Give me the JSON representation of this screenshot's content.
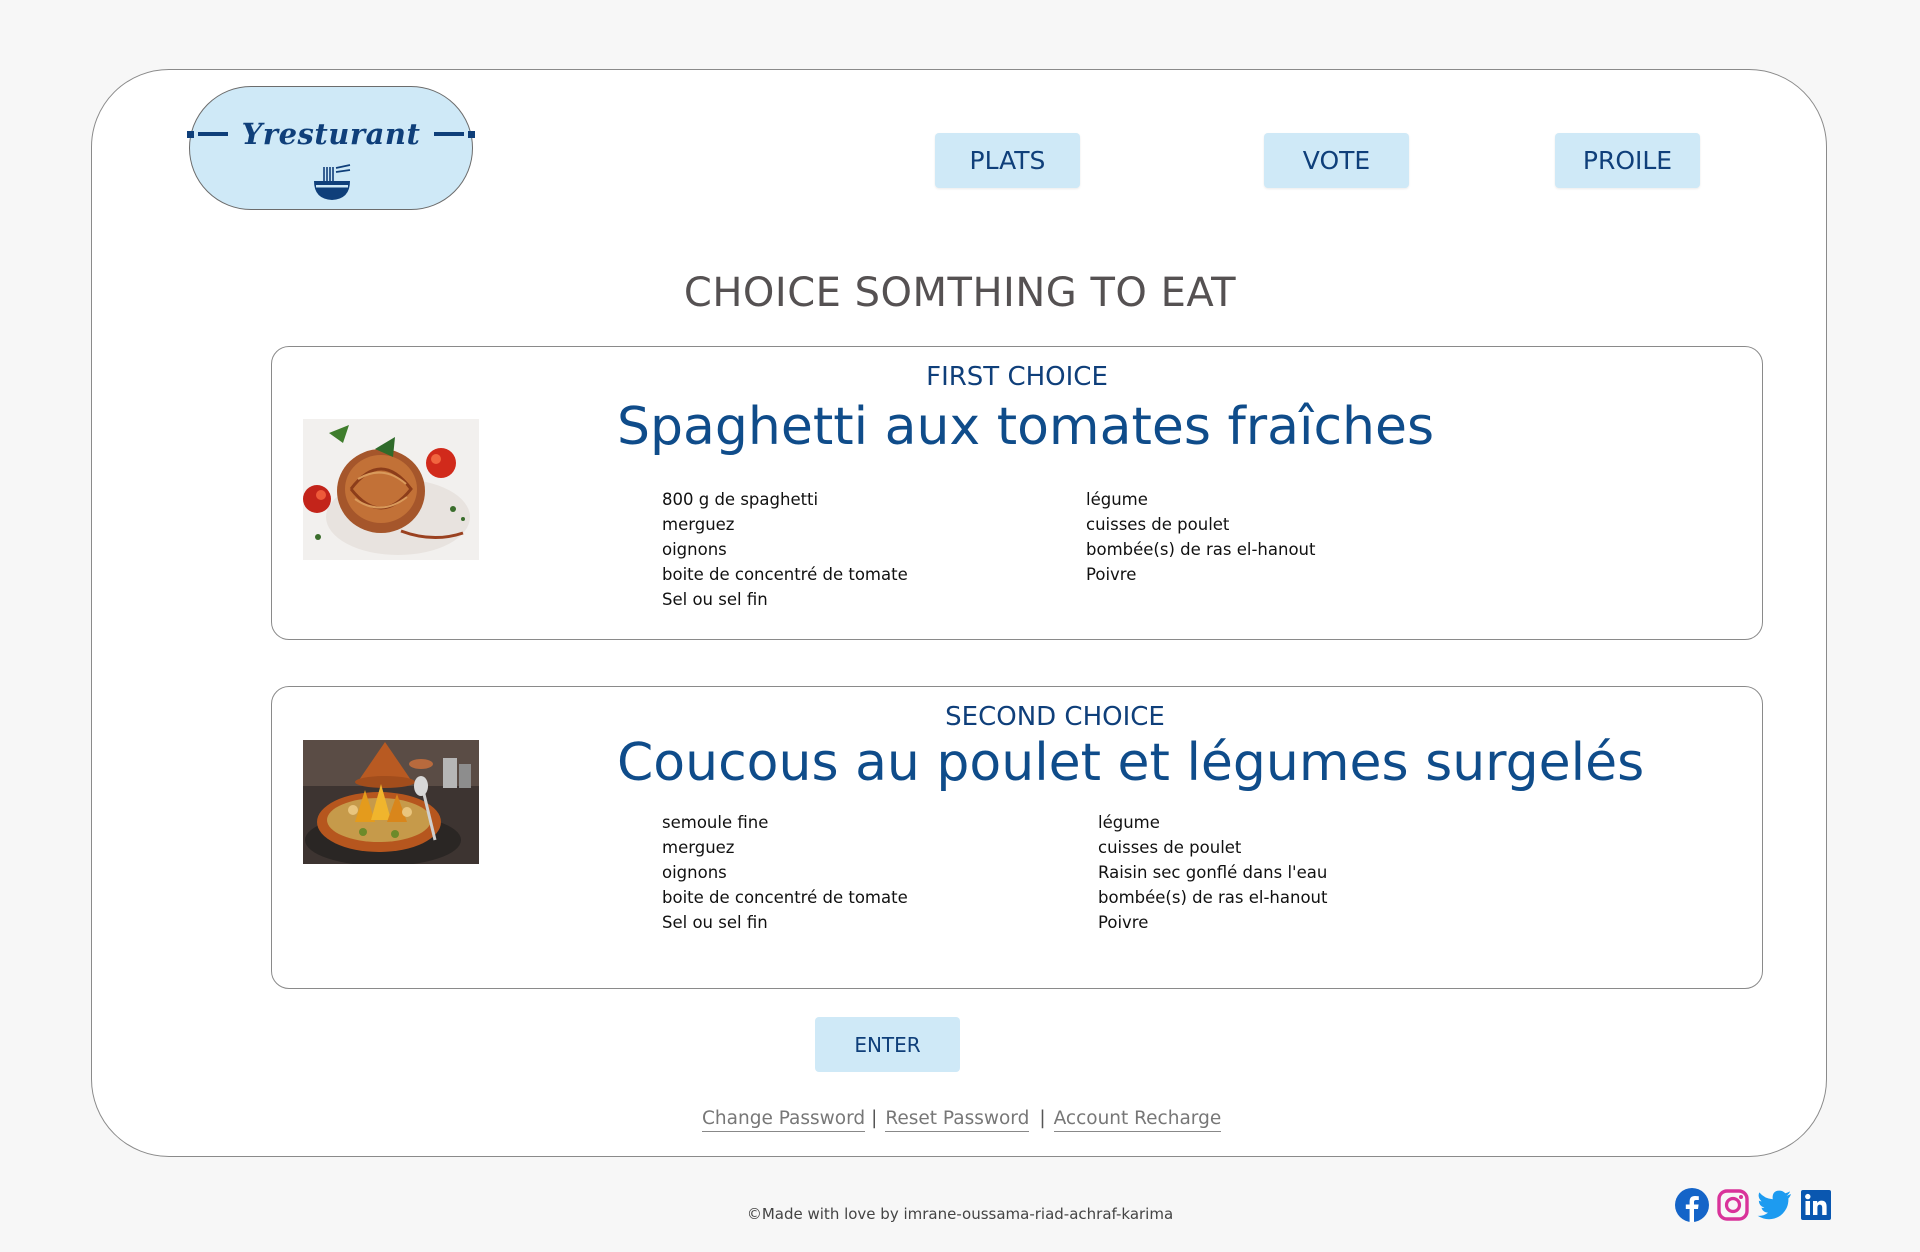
{
  "logo": {
    "text": "Yresturant",
    "icon": "noodle-bowl-icon",
    "color": "#0f3f7a"
  },
  "nav": {
    "plats": "PLATS",
    "vote": "VOTE",
    "profile": "PROILE"
  },
  "page_title": "CHOICE SOMTHING TO EAT",
  "choices": [
    {
      "label": "FIRST CHOICE",
      "name": "Spaghetti aux tomates fraîches",
      "image": "spaghetti-photo",
      "ingredients_left": [
        "800 g de spaghetti",
        "merguez",
        "oignons",
        "boite de concentré de tomate",
        "Sel ou sel fin"
      ],
      "ingredients_right": [
        "légume",
        "cuisses de poulet",
        "bombée(s) de ras el-hanout",
        "Poivre"
      ]
    },
    {
      "label": "SECOND CHOICE",
      "name": "Coucous au poulet et légumes surgelés",
      "image": "couscous-photo",
      "ingredients_left": [
        "semoule fine",
        "merguez",
        "oignons",
        "boite de concentré de tomate",
        "Sel ou sel fin"
      ],
      "ingredients_right": [
        "légume",
        "cuisses de poulet",
        "Raisin sec gonflé dans l'eau",
        "bombée(s) de ras el-hanout",
        "Poivre"
      ]
    }
  ],
  "enter_label": "ENTER",
  "links": {
    "change_password": "Change Password",
    "reset_password": "Reset Password",
    "account_recharge": "Account Recharge",
    "separator": "|"
  },
  "footer": "©Made with love by  imrane-oussama-riad-achraf-karima",
  "socials": [
    "facebook-icon",
    "instagram-icon",
    "twitter-icon",
    "linkedin-icon"
  ],
  "colors": {
    "accent": "#cfe9f7",
    "brand": "#0f3f7a",
    "dish_title": "#0f4c8a",
    "background": "#f7f7f7"
  }
}
